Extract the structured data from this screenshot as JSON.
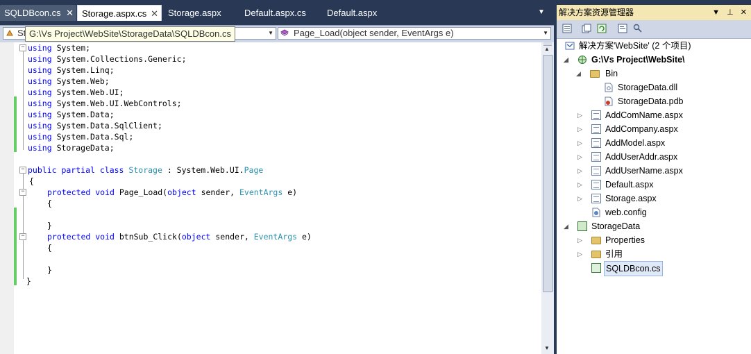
{
  "tabs": [
    {
      "label": "SQLDBcon.cs",
      "close": "✕"
    },
    {
      "label": "Storage.aspx.cs",
      "close": "✕"
    },
    {
      "label": "Storage.aspx"
    },
    {
      "label": "Default.aspx.cs"
    },
    {
      "label": "Default.aspx"
    }
  ],
  "nav": {
    "class_combo": "St",
    "member_combo": "Page_Load(object sender, EventArgs e)",
    "tooltip": "G:\\Vs Project\\WebSite\\StorageData\\SQLDBcon.cs"
  },
  "code": {
    "usings": [
      "System;",
      "System.Collections.Generic;",
      "System.Linq;",
      "System.Web;",
      "System.Web.UI;",
      "System.Web.UI.WebControls;",
      "System.Data;",
      "System.Data.SqlClient;",
      "System.Data.Sql;",
      "StorageData;"
    ],
    "kw_using": "using",
    "class_decl": {
      "mods": "public partial class",
      "name": "Storage",
      "sep": " : System.Web.UI.",
      "base": "Page"
    },
    "open_brace": "{",
    "close_brace": "}",
    "method1": {
      "mods": "protected void",
      "name": " Page_Load(",
      "ptype": "object",
      "p1": " sender, ",
      "etype": "EventArgs",
      "p2": " e)"
    },
    "method2": {
      "mods": "protected void",
      "name": " btnSub_Click(",
      "ptype": "object",
      "p1": " sender, ",
      "etype": "EventArgs",
      "p2": " e)"
    }
  },
  "solution_explorer": {
    "title": "解决方案资源管理器",
    "title_buttons": {
      "dropdown": "▼",
      "pin": "⊥",
      "close": "✕"
    },
    "solution": "解决方案'WebSite' (2 个项目)",
    "website": "G:\\Vs Project\\WebSite\\",
    "bin": "Bin",
    "bin_children": [
      "StorageData.dll",
      "StorageData.pdb"
    ],
    "pages": [
      "AddComName.aspx",
      "AddCompany.aspx",
      "AddModel.aspx",
      "AddUserAddr.aspx",
      "AddUserName.aspx",
      "Default.aspx",
      "Storage.aspx"
    ],
    "webconfig": "web.config",
    "project": "StorageData",
    "project_children": [
      "Properties",
      "引用"
    ],
    "selected_file": "SQLDBcon.cs"
  }
}
